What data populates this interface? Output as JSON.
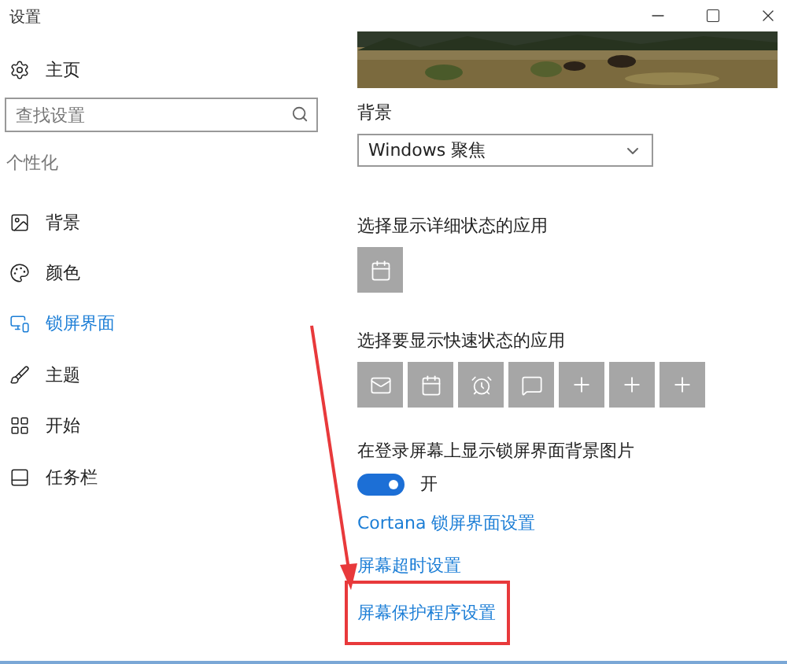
{
  "window": {
    "title": "设置"
  },
  "sidebar": {
    "home": "主页",
    "search": {
      "placeholder": "查找设置"
    },
    "section": "个性化",
    "items": [
      {
        "label": "背景",
        "selected": false
      },
      {
        "label": "颜色",
        "selected": false
      },
      {
        "label": "锁屏界面",
        "selected": true
      },
      {
        "label": "主题",
        "selected": false
      },
      {
        "label": "开始",
        "selected": false
      },
      {
        "label": "任务栏",
        "selected": false
      }
    ]
  },
  "content": {
    "background": {
      "label": "背景",
      "value": "Windows 聚焦"
    },
    "detailed_status": {
      "heading": "选择显示详细状态的应用",
      "apps": [
        {
          "kind": "calendar"
        }
      ]
    },
    "quick_status": {
      "heading": "选择要显示快速状态的应用",
      "apps": [
        {
          "kind": "mail"
        },
        {
          "kind": "calendar"
        },
        {
          "kind": "alarm"
        },
        {
          "kind": "message"
        },
        {
          "kind": "add"
        },
        {
          "kind": "add"
        },
        {
          "kind": "add"
        }
      ]
    },
    "show_background": {
      "label": "在登录屏幕上显示锁屏界面背景图片",
      "on": true,
      "state_text": "开"
    },
    "links": [
      {
        "label": "Cortana 锁屏界面设置",
        "highlighted": false
      },
      {
        "label": "屏幕超时设置",
        "highlighted": false
      },
      {
        "label": "屏幕保护程序设置",
        "highlighted": true
      }
    ]
  },
  "annotation": {
    "arrow": true
  }
}
